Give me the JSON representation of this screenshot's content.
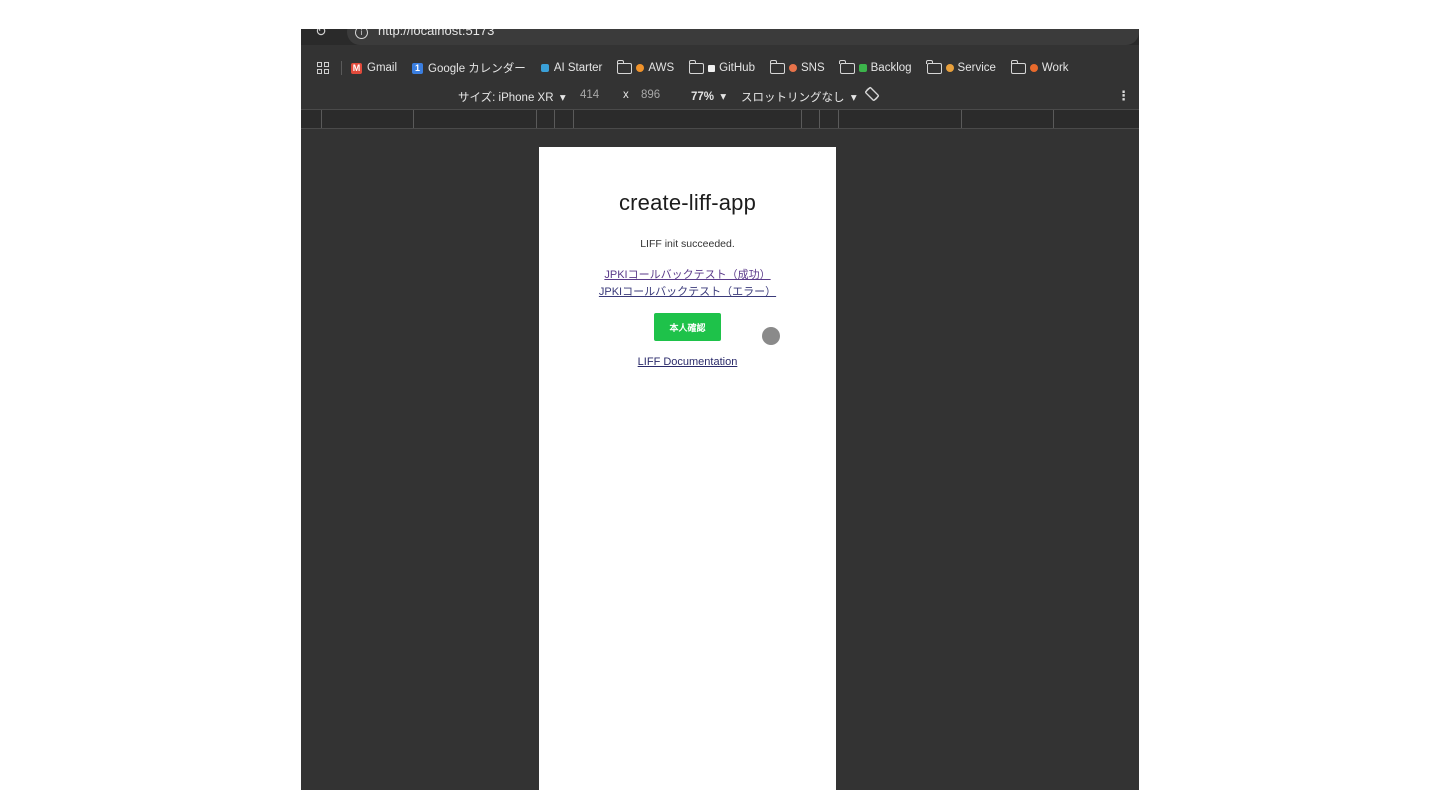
{
  "browser": {
    "url": "http://localhost:5173",
    "bookmarks": [
      {
        "label": "Gmail",
        "type": "site",
        "icon": "gmail-icon",
        "color": "#e24a3b"
      },
      {
        "label": "Google カレンダー",
        "type": "site",
        "icon": "calendar-icon",
        "color": "#3a7ee0"
      },
      {
        "label": "AI Starter",
        "type": "site",
        "icon": "ai-starter-icon",
        "color": "#3aa0d8"
      },
      {
        "label": "AWS",
        "type": "folder",
        "icon": "folder-icon",
        "color": "#f0932b"
      },
      {
        "label": "GitHub",
        "type": "folder",
        "icon": "folder-icon",
        "color": "#f0f0f0"
      },
      {
        "label": "SNS",
        "type": "folder",
        "icon": "folder-icon",
        "color": "#e8734a"
      },
      {
        "label": "Backlog",
        "type": "folder",
        "icon": "folder-icon",
        "color": "#3cb44b"
      },
      {
        "label": "Service",
        "type": "folder",
        "icon": "folder-icon",
        "color": "#e8a03c"
      },
      {
        "label": "Work",
        "type": "folder",
        "icon": "folder-icon",
        "color": "#e86a2c"
      }
    ]
  },
  "device_toolbar": {
    "size_label": "サイズ: iPhone XR",
    "width": "414",
    "times": "x",
    "height": "896",
    "zoom": "77%",
    "throttle": "スロットリングなし"
  },
  "app": {
    "title": "create-liff-app",
    "status": "LIFF init succeeded.",
    "link_success": "JPKIコールバックテスト（成功）",
    "link_error": "JPKIコールバックテスト（エラー）",
    "verify_button": "本人確認",
    "doc_link": "LIFF Documentation",
    "button_color": "#1ec24a"
  }
}
